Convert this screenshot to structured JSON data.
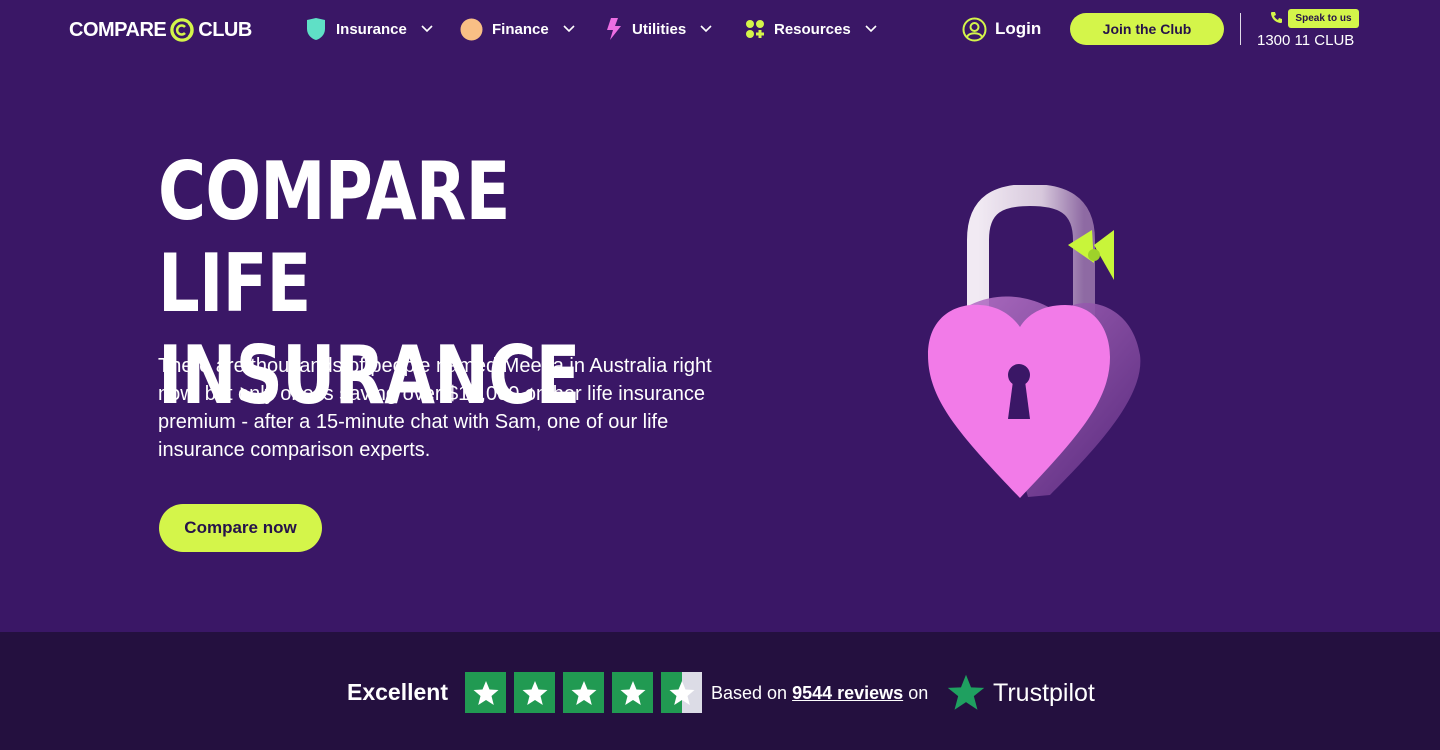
{
  "nav": {
    "logo_left": "COMPARE",
    "logo_right": "CLUB",
    "items": [
      {
        "label": "Insurance",
        "icon": "shield-icon"
      },
      {
        "label": "Finance",
        "icon": "coin-icon"
      },
      {
        "label": "Utilities",
        "icon": "lightning-icon"
      },
      {
        "label": "Resources",
        "icon": "grid-icon"
      }
    ],
    "login_label": "Login",
    "join_label": "Join the Club",
    "speak_label": "Speak to us",
    "phone": "1300 11 CLUB"
  },
  "hero": {
    "title_line1": "COMPARE LIFE",
    "title_line2": "INSURANCE",
    "description": "There are thousands of people named Meena in Australia right now, but only one is saving over $10,000 on her life insurance premium - after a 15-minute chat with Sam, one of our life insurance comparison experts.",
    "cta_label": "Compare now"
  },
  "trust": {
    "rating_word": "Excellent",
    "stars": 4.5,
    "based_prefix": "Based on",
    "reviews_link": "9544 reviews",
    "based_suffix": "on",
    "brand": "Trustpilot"
  },
  "colors": {
    "background": "#3a1766",
    "trust_background": "#24103f",
    "accent": "#d4f54a",
    "star_green": "#219a52",
    "heart_pink": "#f27be8"
  }
}
